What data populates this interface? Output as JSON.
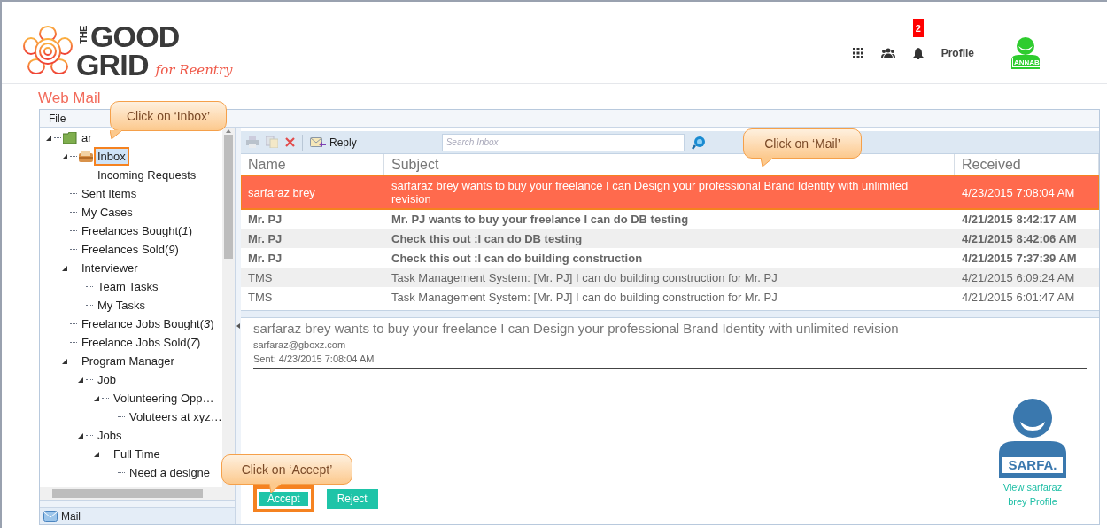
{
  "logo": {
    "the": "THE",
    "line1": "GOOD",
    "line2": "GRID",
    "tagline": "for Reentry"
  },
  "header": {
    "notification_count": "2",
    "profile_label": "Profile",
    "avatar_label": "ANNAB"
  },
  "page_title": "Web Mail",
  "menu": [
    "File"
  ],
  "tree": [
    {
      "label": "ar",
      "expanded": true,
      "selected": false,
      "children": [
        {
          "label": "Inbox",
          "expanded": true,
          "selected": true,
          "children": [
            {
              "label": "Incoming Requests",
              "selected": false
            }
          ]
        },
        {
          "label": "Sent Items",
          "selected": false
        },
        {
          "label": "My Cases",
          "selected": false
        },
        {
          "label": "Freelances Bought(*1*)",
          "selected": false
        },
        {
          "label": "Freelances Sold(*9*)",
          "selected": false
        },
        {
          "label": "Interviewer",
          "expanded": true,
          "selected": false,
          "children": [
            {
              "label": "Team Tasks",
              "selected": false
            },
            {
              "label": "My Tasks",
              "selected": false
            }
          ]
        },
        {
          "label": "Freelance Jobs Bought(*3*)",
          "selected": false
        },
        {
          "label": "Freelance Jobs Sold(*7*)",
          "selected": false
        },
        {
          "label": "Program Manager",
          "expanded": true,
          "selected": false,
          "children": [
            {
              "label": "Job",
              "expanded": true,
              "selected": false,
              "children": [
                {
                  "label": "Volunteering Opp…",
                  "expanded": true,
                  "selected": false,
                  "children": [
                    {
                      "label": "Voluteers at xyz…",
                      "selected": false
                    }
                  ]
                }
              ]
            },
            {
              "label": "Jobs",
              "expanded": true,
              "selected": false,
              "children": [
                {
                  "label": "Full Time",
                  "expanded": true,
                  "selected": false,
                  "children": [
                    {
                      "label": "Need a designe",
                      "selected": false
                    }
                  ]
                }
              ]
            }
          ]
        }
      ]
    }
  ],
  "nav_bottom": {
    "label": "Mail"
  },
  "toolbar": {
    "reply_label": "Reply",
    "search_placeholder": "Search Inbox"
  },
  "table": {
    "columns": [
      "Name",
      "Subject",
      "Received"
    ],
    "rows": [
      {
        "name": "sarfaraz brey",
        "subject": "sarfaraz brey wants to buy your freelance I can Design your professional Brand Identity with unlimited revision",
        "received": "4/23/2015 7:08:04 AM",
        "unread": false,
        "selected": true
      },
      {
        "name": "Mr. PJ",
        "subject": "Mr. PJ wants to buy your freelance I can do DB testing",
        "received": "4/21/2015 8:42:17 AM",
        "unread": true,
        "selected": false
      },
      {
        "name": "Mr. PJ",
        "subject": "Check this out :I can do DB testing",
        "received": "4/21/2015 8:42:06 AM",
        "unread": true,
        "selected": false
      },
      {
        "name": "Mr. PJ",
        "subject": "Check this out :I can do building construction",
        "received": "4/21/2015 7:37:39 AM",
        "unread": true,
        "selected": false
      },
      {
        "name": "TMS",
        "subject": "Task Management System: [Mr. PJ] I can do building construction for Mr. PJ",
        "received": "4/21/2015 6:09:24 AM",
        "unread": false,
        "selected": false
      },
      {
        "name": "TMS",
        "subject": "Task Management System: [Mr. PJ] I can do building construction for Mr. PJ",
        "received": "4/21/2015 6:01:47 AM",
        "unread": false,
        "selected": false
      }
    ]
  },
  "preview": {
    "subject": "sarfaraz brey wants to buy your freelance I can Design your professional Brand Identity with unlimited revision",
    "email": "sarfaraz@gboxz.com",
    "sent": "Sent: 4/23/2015 7:08:04 AM",
    "buttons": [
      {
        "label": "Accept",
        "highlighted": true
      },
      {
        "label": "Reject",
        "highlighted": false
      }
    ],
    "sender_avatar_label": "SARFA.",
    "profile_link": "View sarfaraz brey Profile"
  },
  "callouts": [
    {
      "text": "Click on ‘Inbox’"
    },
    {
      "text": "Click on ‘Mail’"
    },
    {
      "text": "Click on ‘Accept’"
    }
  ]
}
